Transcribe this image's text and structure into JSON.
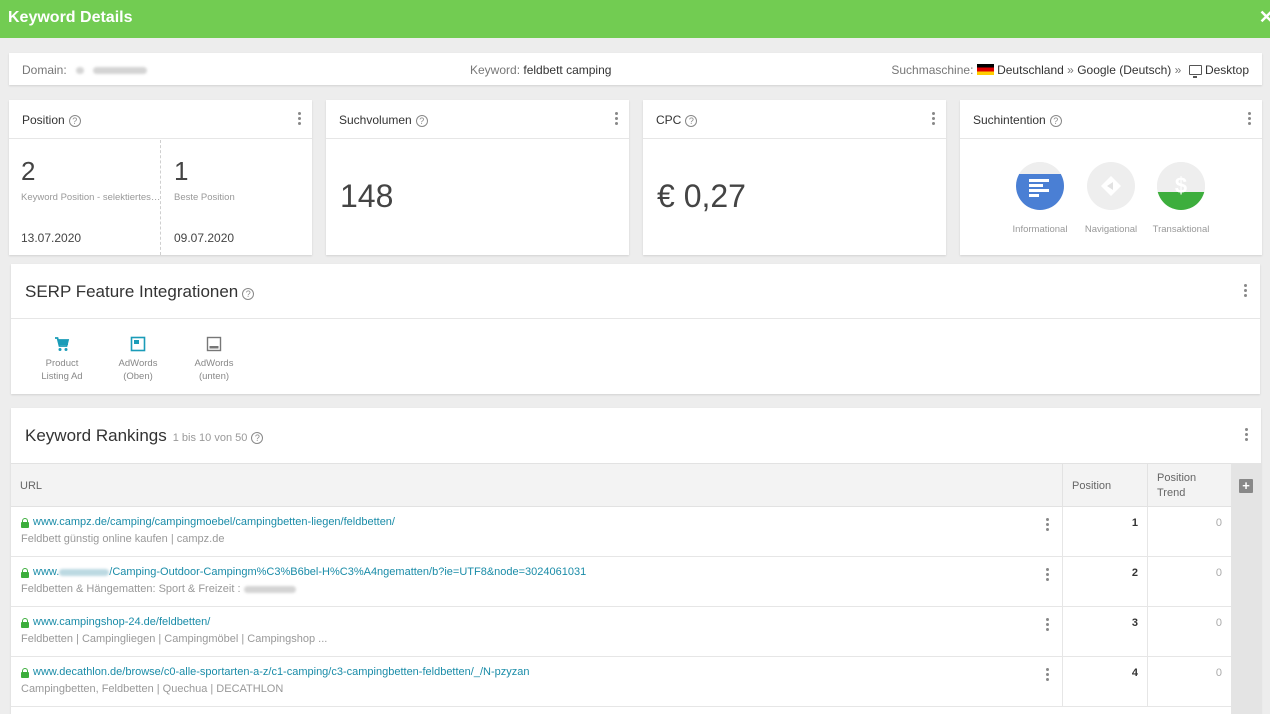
{
  "header": {
    "title": "Keyword Details",
    "close_icon": "close-icon"
  },
  "infobar": {
    "domain_label": "Domain:",
    "keyword_label": "Keyword:",
    "keyword_value": "feldbett camping",
    "engine_label": "Suchmaschine:",
    "country": "Deutschland",
    "sep1": "»",
    "engine": "Google",
    "language": "(Deutsch)",
    "sep2": "»",
    "device": "Desktop"
  },
  "position_card": {
    "title": "Position",
    "current": {
      "value": "2",
      "label": "Keyword Position - selektiertes ...",
      "date": "13.07.2020"
    },
    "best": {
      "value": "1",
      "label": "Beste Position",
      "date": "09.07.2020"
    }
  },
  "volume_card": {
    "title": "Suchvolumen",
    "value": "148"
  },
  "cpc_card": {
    "title": "CPC",
    "value": "€ 0,27"
  },
  "intent_card": {
    "title": "Suchintention",
    "items": [
      {
        "label": "Informational",
        "active": true,
        "color": "#4a7fd4",
        "icon": "lines-icon"
      },
      {
        "label": "Navigational",
        "active": false,
        "color": "#eeeeee",
        "icon": "compass-icon"
      },
      {
        "label": "Transaktional",
        "active": true,
        "color": "#3dae3d",
        "icon": "dollar-icon"
      }
    ]
  },
  "serp_card": {
    "title": "SERP Feature Integrationen",
    "features": [
      {
        "line1": "Product",
        "line2": "Listing Ad",
        "icon": "cart-icon"
      },
      {
        "line1": "AdWords",
        "line2": "(Oben)",
        "icon": "ad-top-icon"
      },
      {
        "line1": "AdWords",
        "line2": "(unten)",
        "icon": "ad-bottom-icon"
      }
    ]
  },
  "rankings": {
    "title": "Keyword Rankings",
    "count": "1 bis 10 von 50",
    "columns": {
      "url": "URL",
      "position": "Position",
      "trend_line1": "Position",
      "trend_line2": "Trend"
    },
    "rows": [
      {
        "url": "www.campz.de/camping/campingmoebel/campingbetten-liegen/feldbetten/",
        "desc": "Feldbett günstig online kaufen | campz.de",
        "position": "1",
        "trend": "0"
      },
      {
        "url_pre": "www.",
        "url_post": "/Camping-Outdoor-Campingm%C3%B6bel-H%C3%A4ngematten/b?ie=UTF8&node=3024061031",
        "desc": "Feldbetten & Hängematten: Sport & Freizeit :",
        "position": "2",
        "trend": "0"
      },
      {
        "url": "www.campingshop-24.de/feldbetten/",
        "desc": "Feldbetten | Campingliegen | Campingmöbel | Campingshop ...",
        "position": "3",
        "trend": "0"
      },
      {
        "url": "www.decathlon.de/browse/c0-alle-sportarten-a-z/c1-camping/c3-campingbetten-feldbetten/_/N-pzyzan",
        "desc": "Campingbetten, Feldbetten | Quechua | DECATHLON",
        "position": "4",
        "trend": "0"
      }
    ]
  }
}
